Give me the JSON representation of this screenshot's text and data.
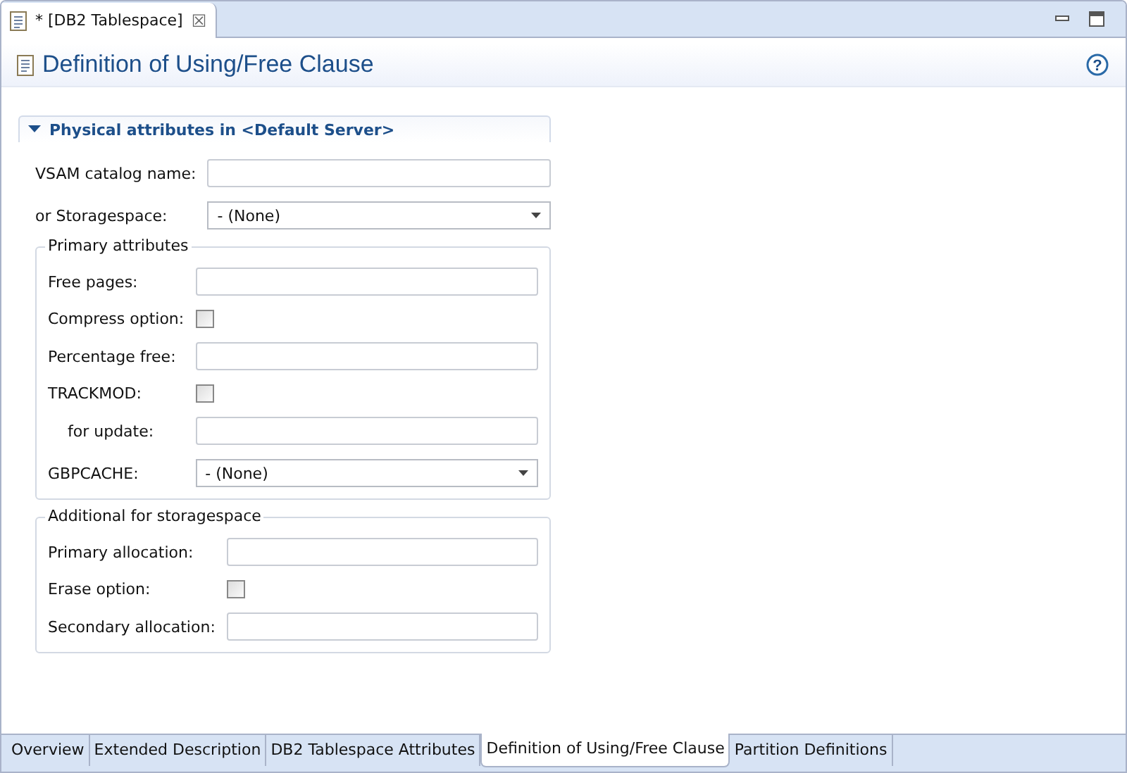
{
  "editor_tab": {
    "label": "* [DB2 Tablespace]",
    "close": "☒"
  },
  "header": {
    "title": "Definition of Using/Free Clause",
    "help": "?"
  },
  "section": {
    "title": "Physical attributes in <Default Server>",
    "expanded": true,
    "rows": [
      {
        "kind": "text",
        "label": "VSAM catalog name:",
        "indented": false
      },
      {
        "kind": "select",
        "label": "or Storagespace:",
        "value": "- (None)",
        "indented": false
      }
    ],
    "groups": [
      {
        "title": "Primary attributes",
        "rows": [
          {
            "kind": "text",
            "label": "Free pages:",
            "indented": false
          },
          {
            "kind": "checkbox",
            "label": "Compress option:",
            "checked": false,
            "indented": false
          },
          {
            "kind": "text",
            "label": "Percentage free:",
            "indented": false
          },
          {
            "kind": "checkbox",
            "label": "TRACKMOD:",
            "checked": false,
            "indented": false
          },
          {
            "kind": "text",
            "label": "for update:",
            "indented": true
          },
          {
            "kind": "select",
            "label": "GBPCACHE:",
            "value": "- (None)",
            "indented": false
          }
        ]
      },
      {
        "title": "Additional for storagespace",
        "rows": [
          {
            "kind": "text",
            "label": "Primary allocation:",
            "indented": false
          },
          {
            "kind": "checkbox",
            "label": "Erase option:",
            "checked": false,
            "indented": false
          },
          {
            "kind": "text",
            "label": "Secondary allocation:",
            "indented": false
          }
        ]
      }
    ]
  },
  "bottom_tabs": [
    {
      "label": "Overview",
      "selected": false
    },
    {
      "label": "Extended Description",
      "selected": false
    },
    {
      "label": "DB2 Tablespace Attributes",
      "selected": false
    },
    {
      "label": "Definition of Using/Free Clause",
      "selected": true
    },
    {
      "label": "Partition Definitions",
      "selected": false
    }
  ]
}
